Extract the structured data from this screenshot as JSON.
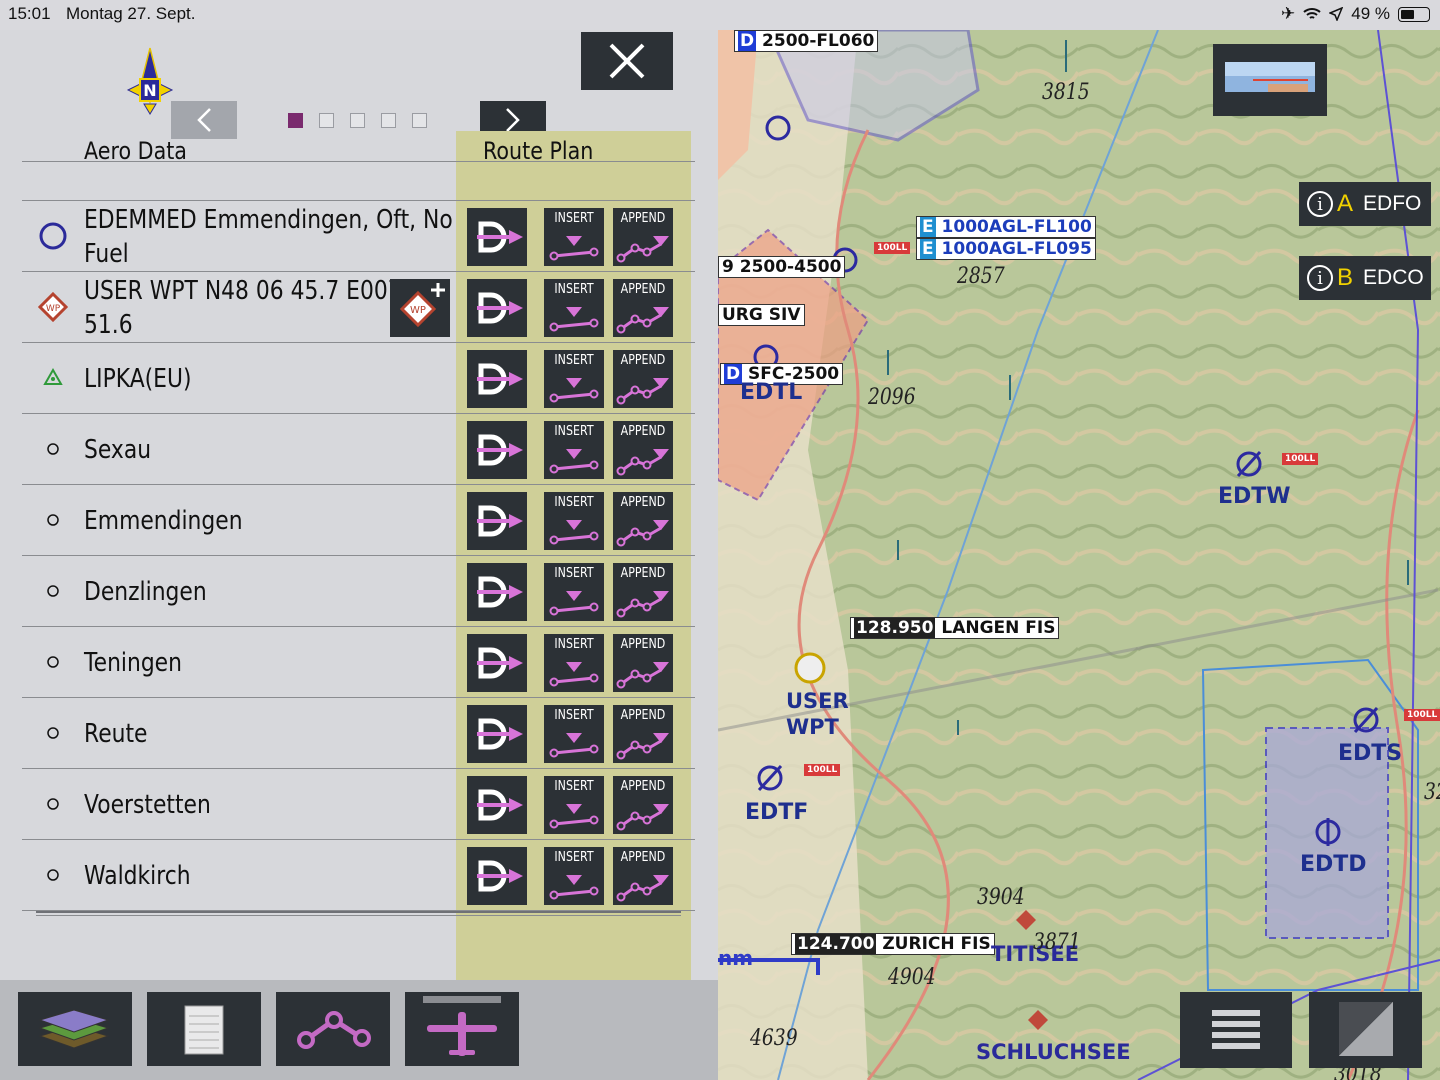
{
  "status": {
    "time": "15:01",
    "date": "Montag 27. Sept.",
    "battery": "49 %"
  },
  "compass": {
    "letter": "N"
  },
  "pager": {
    "total": 5,
    "active": 0
  },
  "headers": {
    "aero": "Aero Data",
    "route": "Route Plan"
  },
  "buttons": {
    "insert": "INSERT",
    "append": "APPEND"
  },
  "rows": [
    {
      "name": "EDEMMED Emmendingen, Oft, No Fuel",
      "icon": "airport-circle-icon"
    },
    {
      "name": "USER WPT N48 06 45.7 E007 51.6",
      "icon": "user-waypoint-icon"
    },
    {
      "name": "LIPKA(EU)",
      "icon": "reporting-point-triangle-icon"
    },
    {
      "name": "Sexau",
      "icon": "small-circle-icon"
    },
    {
      "name": "Emmendingen",
      "icon": "small-circle-icon"
    },
    {
      "name": "Denzlingen",
      "icon": "small-circle-icon"
    },
    {
      "name": "Teningen",
      "icon": "small-circle-icon"
    },
    {
      "name": "Reute",
      "icon": "small-circle-icon"
    },
    {
      "name": "Voerstetten",
      "icon": "small-circle-icon"
    },
    {
      "name": "Waldkirch",
      "icon": "small-circle-icon"
    }
  ],
  "map": {
    "airspaces": [
      {
        "cls": "D",
        "text": "2500-FL060"
      },
      {
        "cls": "E",
        "text": "1000AGL-FL100"
      },
      {
        "cls": "E",
        "text": "1000AGL-FL095"
      },
      {
        "cls": "D",
        "text": "SFC-2500"
      },
      {
        "cls": "",
        "text": "9 2500-4500"
      },
      {
        "cls": "",
        "text": "URG SIV"
      }
    ],
    "freqs": [
      {
        "freq": "128.950",
        "name": "LANGEN FIS"
      },
      {
        "freq": "124.700",
        "name": "ZURICH FIS"
      }
    ],
    "airports": [
      "EDTL",
      "EDTW",
      "EDTS",
      "EDTD",
      "EDTF"
    ],
    "places": [
      "TITISEE",
      "SCHLUCHSEE"
    ],
    "user_wpt": "USER WPT",
    "elevations": [
      "3815",
      "2857",
      "2096",
      "3904",
      "3871",
      "4904",
      "4639",
      "3018",
      "32"
    ],
    "fuel_tag": "100LL",
    "info_buttons": [
      {
        "slot": "A",
        "code": "EDFO"
      },
      {
        "slot": "B",
        "code": "EDCO"
      }
    ],
    "scale_unit": "nm"
  }
}
